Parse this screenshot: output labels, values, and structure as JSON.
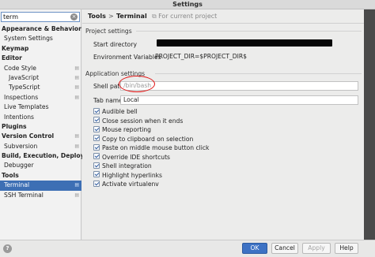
{
  "window": {
    "title": "Settings"
  },
  "search": {
    "value": "term"
  },
  "tree": [
    {
      "label": "Appearance & Behavior",
      "indent": 0,
      "bold": true,
      "cfg": false
    },
    {
      "label": "System Settings",
      "indent": 1,
      "bold": false,
      "cfg": false
    },
    {
      "label": "Keymap",
      "indent": 0,
      "bold": true,
      "cfg": false
    },
    {
      "label": "Editor",
      "indent": 0,
      "bold": true,
      "cfg": false
    },
    {
      "label": "Code Style",
      "indent": 1,
      "bold": false,
      "cfg": true
    },
    {
      "label": "JavaScript",
      "indent": 2,
      "bold": false,
      "cfg": true
    },
    {
      "label": "TypeScript",
      "indent": 2,
      "bold": false,
      "cfg": true
    },
    {
      "label": "Inspections",
      "indent": 1,
      "bold": false,
      "cfg": true
    },
    {
      "label": "Live Templates",
      "indent": 1,
      "bold": false,
      "cfg": false
    },
    {
      "label": "Intentions",
      "indent": 1,
      "bold": false,
      "cfg": false
    },
    {
      "label": "Plugins",
      "indent": 0,
      "bold": true,
      "cfg": false
    },
    {
      "label": "Version Control",
      "indent": 0,
      "bold": true,
      "cfg": true
    },
    {
      "label": "Subversion",
      "indent": 1,
      "bold": false,
      "cfg": true
    },
    {
      "label": "Build, Execution, Deployment",
      "indent": 0,
      "bold": true,
      "cfg": false
    },
    {
      "label": "Debugger",
      "indent": 1,
      "bold": false,
      "cfg": false
    },
    {
      "label": "Tools",
      "indent": 0,
      "bold": true,
      "cfg": false
    },
    {
      "label": "Terminal",
      "indent": 1,
      "bold": false,
      "cfg": true,
      "selected": true
    },
    {
      "label": "SSH Terminal",
      "indent": 1,
      "bold": false,
      "cfg": true
    }
  ],
  "breadcrumb": {
    "parent": "Tools",
    "separator": ">",
    "current": "Terminal",
    "scope": "For current project"
  },
  "project_settings": {
    "title": "Project settings",
    "start_dir_label": "Start directory",
    "env_label": "Environment Variables",
    "env_value": "PROJECT_DIR=$PROJECT_DIR$"
  },
  "app_settings": {
    "title": "Application settings",
    "shell_label": "Shell path",
    "shell_value": "/bin/bash",
    "tab_label": "Tab name",
    "tab_value": "Local",
    "checkboxes": [
      "Audible bell",
      "Close session when it ends",
      "Mouse reporting",
      "Copy to clipboard on selection",
      "Paste on middle mouse button click",
      "Override IDE shortcuts",
      "Shell integration",
      "Highlight hyperlinks",
      "Activate virtualenv"
    ]
  },
  "buttons": {
    "ok": "OK",
    "cancel": "Cancel",
    "apply": "Apply",
    "help": "Help"
  },
  "colors": {
    "selection": "#3d6fb4",
    "annotation": "#e01010",
    "ok_button": "#3d72c4"
  }
}
